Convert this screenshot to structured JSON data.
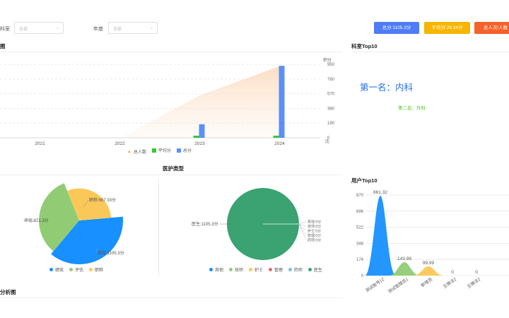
{
  "filters": {
    "dept_label": "科室",
    "dept_value": "全部",
    "year_label": "年度",
    "year_value": "全部"
  },
  "buttons": {
    "total_score": "总分:1105.3分",
    "avg_score": "平均分:28.34分",
    "per_capita": "总人次/人数"
  },
  "colors": {
    "blue": "#5b8ff9",
    "yellow": "#fac858",
    "orange": "#f5612a",
    "green": "#91cc75",
    "dark_green": "#3ba272",
    "red": "#ee6666"
  },
  "trend": {
    "title": "图",
    "y_right_label": "积分",
    "y_right_label2": "比",
    "y_ticks": [
      "950",
      "760",
      "570",
      "380",
      "190",
      "0"
    ],
    "legend": [
      "总人数",
      "平均分",
      "总分"
    ],
    "chart_data": {
      "type": "bar",
      "categories": [
        "2021",
        "2022",
        "2023",
        "2024"
      ],
      "series": [
        {
          "name": "总人数",
          "values": [
            0,
            0,
            18,
            37
          ]
        },
        {
          "name": "平均分",
          "values": [
            0,
            0,
            18,
            36
          ]
        },
        {
          "name": "总分",
          "values": [
            0,
            0,
            175,
            930
          ]
        }
      ],
      "ylim": [
        0,
        950
      ]
    }
  },
  "dept_top": {
    "title": "科室Top10",
    "first": "第一名：内科",
    "second": "第二名：外科"
  },
  "care_types": {
    "title": "医护类型"
  },
  "pie_left": {
    "legend": [
      "绩效",
      "评优",
      "职称"
    ],
    "labels": [
      "职称:667.33分",
      "评优:971.3分",
      "绩效:1105.3分"
    ],
    "chart_data": {
      "type": "pie",
      "rose": true,
      "categories": [
        "绩效",
        "评优",
        "职称"
      ],
      "values": [
        1105.3,
        971.3,
        667.33
      ]
    }
  },
  "pie_right": {
    "legend": [
      "其他",
      "技师",
      "护士",
      "管理",
      "药师",
      "医生"
    ],
    "labels": [
      "医生:1105.3分",
      "其他:0分",
      "技师:0分",
      "护士:0分",
      "管理:0分",
      "药师:0分"
    ],
    "chart_data": {
      "type": "pie",
      "categories": [
        "医生",
        "其他",
        "技师",
        "护士",
        "管理",
        "药师"
      ],
      "values": [
        1105.3,
        0,
        0,
        0,
        0,
        0
      ]
    }
  },
  "user_top": {
    "title": "用户Top10",
    "y_ticks": [
      "870",
      "696",
      "522",
      "348",
      "174",
      "0"
    ],
    "x_labels": [
      "测试账号12",
      "测试管理员1",
      "新增员",
      "王德法2",
      "王德法2"
    ],
    "chart_data": {
      "type": "area",
      "categories": [
        "测试账号12",
        "测试管理员1",
        "新增员",
        "王德法2",
        "王德法2"
      ],
      "values": [
        861.32,
        143.99,
        99.99,
        0,
        0
      ],
      "ylim": [
        0,
        870
      ]
    }
  },
  "analysis": {
    "title": "分析图"
  }
}
